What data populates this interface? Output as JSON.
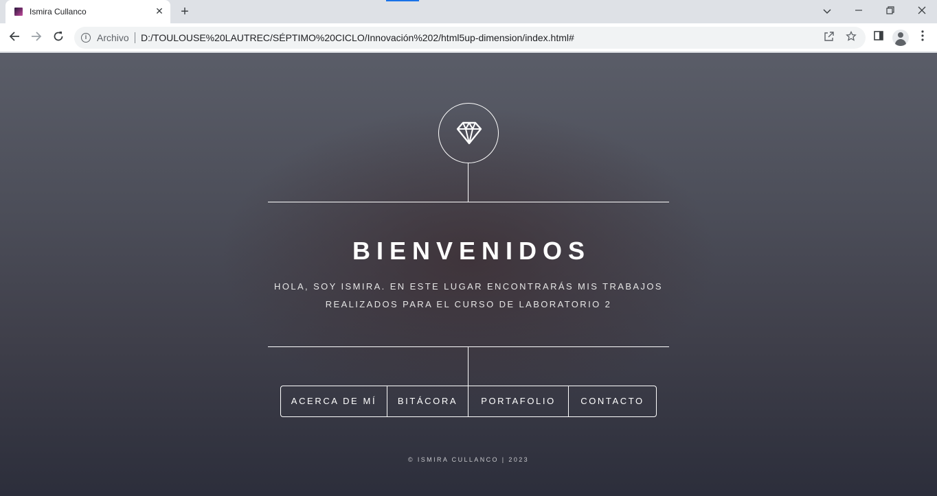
{
  "browser": {
    "tab_title": "Ismira Cullanco",
    "tab_close": "✕",
    "new_tab": "+",
    "omnibox_label": "Archivo",
    "url": "D:/TOULOUSE%20LAUTREC/SÉPTIMO%20CICLO/Innovación%202/html5up-dimension/index.html#",
    "icons": [
      "favicon",
      "close-icon",
      "new-tab-icon",
      "tab-search-icon",
      "minimize-icon",
      "restore-icon",
      "close-window-icon",
      "back-icon",
      "forward-icon",
      "reload-icon",
      "info-icon",
      "share-icon",
      "bookmark-star-icon",
      "side-panel-icon",
      "profile-icon",
      "menu-icon"
    ]
  },
  "page": {
    "logo_icon": "diamond-icon",
    "title": "BIENVENIDOS",
    "subtitle_line1": "HOLA, SOY ISMIRA. EN ESTE LUGAR ENCONTRARÁS MIS TRABAJOS",
    "subtitle_line2": "REALIZADOS PARA EL CURSO DE LABORATORIO 2",
    "nav": [
      {
        "label": "ACERCA DE MÍ"
      },
      {
        "label": "BITÁCORA"
      },
      {
        "label": "PORTAFOLIO"
      },
      {
        "label": "CONTACTO"
      }
    ],
    "footer": "© ISMIRA CULLANCO | 2023"
  },
  "colors": {
    "accent_blue": "#1a73e8",
    "bg_top": "#5a5d68",
    "bg_bottom": "#2c2e3b",
    "line": "#ffffff"
  }
}
